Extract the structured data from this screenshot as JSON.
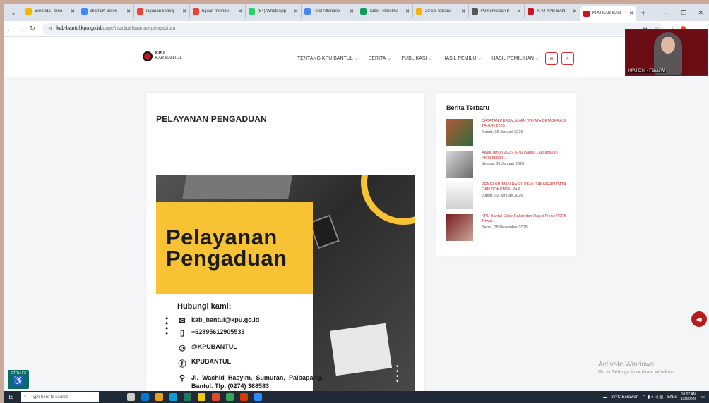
{
  "browser": {
    "tabs": [
      {
        "label": "Beranda - Goo",
        "color": "#f4b400"
      },
      {
        "label": "draft LK Selek",
        "color": "#4285f4"
      },
      {
        "label": "layanan kepeg",
        "color": "#ea4335"
      },
      {
        "label": "tujuan membu",
        "color": "#ea4335"
      },
      {
        "label": "(54) WhatsApp",
        "color": "#25d366"
      },
      {
        "label": "Post Attendee",
        "color": "#4285f4"
      },
      {
        "label": "Tabel Pemeliha",
        "color": "#0f9d58"
      },
      {
        "label": "20 c.8 Sarana",
        "color": "#f4b400"
      },
      {
        "label": "Pemeriksaan 8",
        "color": "#555555"
      },
      {
        "label": "KPU KAB-BAN",
        "color": "#c4161c"
      },
      {
        "label": "KPU KAB-BAN",
        "color": "#c4161c",
        "active": true
      }
    ],
    "url_host": "kab-bantul.kpu.go.id",
    "url_path": "/page/read/pelayanan-pengaduan"
  },
  "site": {
    "logo_line1": "KPU",
    "logo_line2": "KAB·BANTUL",
    "nav": [
      "TENTANG KPU BANTUL",
      "BERITA",
      "PUBLIKASI",
      "HASIL PEMILU",
      "HASIL PEMILIHAN"
    ]
  },
  "main": {
    "title": "PELAYANAN PENGADUAN",
    "poster": {
      "line1": "Pelayanan",
      "line2": "Pengaduan",
      "contact_heading": "Hubungi kami:",
      "email": "kab_bantul@kpu.go.id",
      "phone": "+62895612905533",
      "instagram": "@KPUBANTUL",
      "facebook": "KPUBANTUL",
      "address": "Jl. Wachid Hasyim, Sumuran, Palbapang, Bantul. Tlp. (0274) 368583"
    }
  },
  "sidebar": {
    "title": "Berita Terbaru",
    "news": [
      {
        "title": "CATATAN PERJALANAN WIYATA DEMOKRASI TAHUN 2025",
        "date": "Jumat, 09 Januari 2026"
      },
      {
        "title": "Awali Tahun 2026, KPU Bantul Laksanakan Penandatan...",
        "date": "Selasa, 06 Januari 2026"
      },
      {
        "title": "PENGUMUMAN HASIL PEMUTAKHIRAN DATA DAN DOKUMEN PAR...",
        "date": "Jumat, 02 Januari 2026"
      },
      {
        "title": "KPU Bantul Gelar Rakor dan Rapat Pleno PDPB Triwul...",
        "date": "Senin, 08 Desember 2025"
      }
    ]
  },
  "video": {
    "label": "KPU DIY - Fitnai W"
  },
  "windows": {
    "activate_line1": "Activate Windows",
    "activate_line2": "Go to Settings to activate Windows.",
    "ctrl_label": "CTRL+F2"
  },
  "taskbar": {
    "search_placeholder": "Type here to search",
    "weather": "27°C Berawan",
    "lang": "ENG",
    "time": "10:07 AM",
    "date": "1/28/2026"
  },
  "colors": {
    "accent": "#d32f2f",
    "poster_yellow": "#f7c234",
    "taskbar": "#1f2a36"
  }
}
